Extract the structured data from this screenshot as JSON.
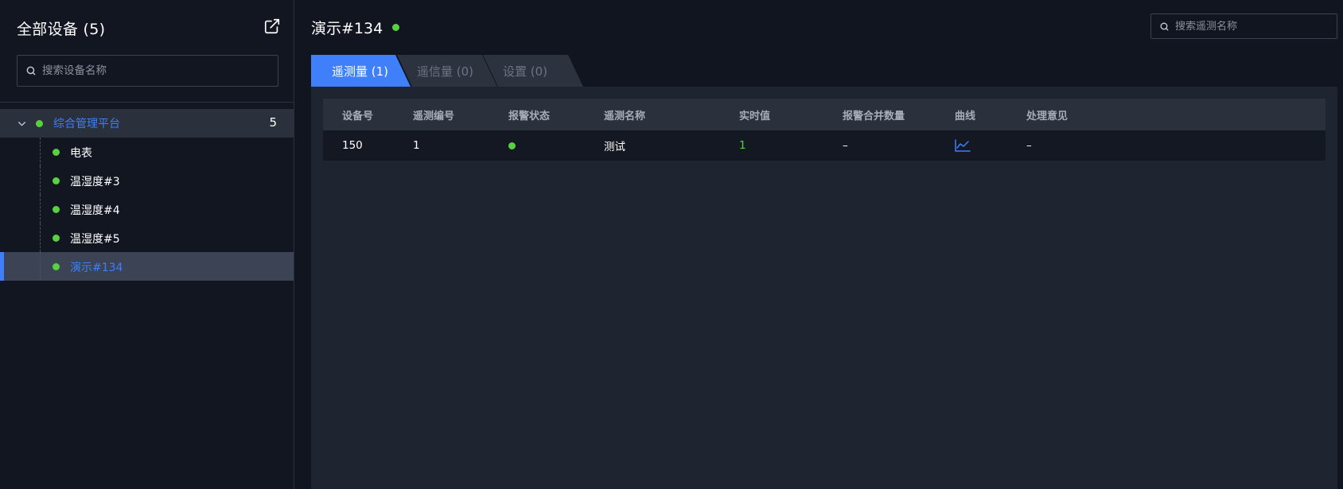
{
  "sidebar": {
    "title": "全部设备 (5)",
    "search_placeholder": "搜索设备名称",
    "root": {
      "label": "综合管理平台",
      "count": "5"
    },
    "items": [
      {
        "label": "电表"
      },
      {
        "label": "温湿度#3"
      },
      {
        "label": "温湿度#4"
      },
      {
        "label": "温湿度#5"
      },
      {
        "label": "演示#134",
        "selected": true
      }
    ]
  },
  "main": {
    "title": "演示#134",
    "status_color": "#58d13f",
    "search_placeholder": "搜索遥测名称",
    "tabs": [
      {
        "label": "遥测量 (1)",
        "active": true
      },
      {
        "label": "遥信量 (0)",
        "active": false
      },
      {
        "label": "设置 (0)",
        "active": false
      }
    ],
    "table": {
      "headers": [
        "设备号",
        "遥测编号",
        "报警状态",
        "遥测名称",
        "实时值",
        "报警合并数量",
        "曲线",
        "处理意见"
      ],
      "rows": [
        {
          "device_no": "150",
          "telemetry_no": "1",
          "alarm_status": "normal",
          "telemetry_name": "测试",
          "realtime_value": "1",
          "alarm_merge_count": "–",
          "curve_icon": "line-chart-icon",
          "handling_opinion": "–"
        }
      ]
    }
  },
  "colors": {
    "accent": "#3f7ffa",
    "online": "#58d13f",
    "bg": "#11151f",
    "panel": "#1f2431"
  }
}
